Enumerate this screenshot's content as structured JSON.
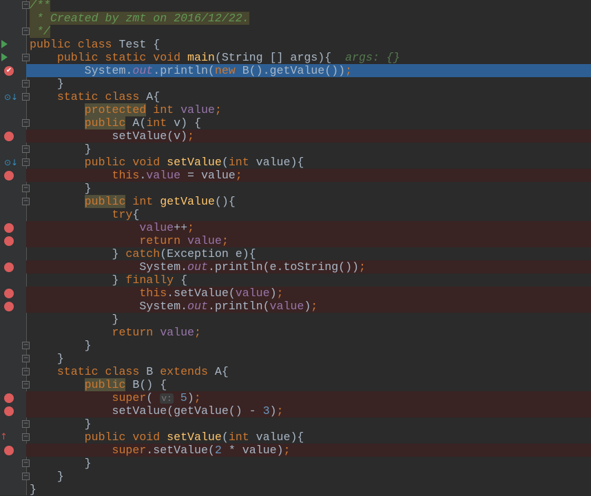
{
  "colors": {
    "keyword": "#cc7832",
    "comment": "#629755",
    "method": "#ffc66d",
    "field": "#9876aa",
    "number": "#6897bb",
    "text": "#a9b7c6",
    "current_line": "#2d5f94",
    "breakpoint_line": "#3a2323"
  },
  "lines": [
    {
      "fold": "start",
      "t": [
        [
          "/**",
          "cm cmbg"
        ]
      ]
    },
    {
      "t": [
        [
          " * Created by zmt on 2016/12/22.",
          "cm cmbg"
        ]
      ]
    },
    {
      "fold": "end",
      "t": [
        [
          " */",
          "cm cmbg"
        ]
      ]
    },
    {
      "marker": "run",
      "t": [
        [
          "public class ",
          "kw"
        ],
        [
          "Test {",
          "pl"
        ]
      ]
    },
    {
      "marker": "run",
      "fold": "start",
      "t": [
        [
          "    public static void ",
          "kw"
        ],
        [
          "main",
          "fn"
        ],
        [
          "(String [] args){  ",
          "pl"
        ],
        [
          "args: {}",
          "dbg"
        ]
      ]
    },
    {
      "marker": "breakpoint-check",
      "bg": "cur",
      "t": [
        [
          "        System.",
          "pl"
        ],
        [
          "out",
          "fldi"
        ],
        [
          ".println(",
          "pl"
        ],
        [
          "new ",
          "kw"
        ],
        [
          "B().getValue())",
          "pl"
        ],
        [
          ";",
          "kw"
        ]
      ]
    },
    {
      "fold": "end",
      "t": [
        [
          "    }",
          "pl"
        ]
      ]
    },
    {
      "marker": "implemented",
      "fold": "start",
      "t": [
        [
          "    static class ",
          "kw"
        ],
        [
          "A{",
          "pl"
        ]
      ]
    },
    {
      "t": [
        [
          "        ",
          "pl"
        ],
        [
          "protected",
          "kw warn"
        ],
        [
          " int ",
          "kw"
        ],
        [
          "value",
          "fld"
        ],
        [
          ";",
          "kw"
        ]
      ]
    },
    {
      "fold": "start",
      "t": [
        [
          "        ",
          "pl"
        ],
        [
          "public",
          "kw warn"
        ],
        [
          " A(",
          "pl"
        ],
        [
          "int ",
          "kw"
        ],
        [
          "v) {",
          "pl"
        ]
      ]
    },
    {
      "marker": "breakpoint",
      "bg": "bp",
      "t": [
        [
          "            setValue(v)",
          "pl"
        ],
        [
          ";",
          "kw"
        ]
      ]
    },
    {
      "fold": "end",
      "t": [
        [
          "        }",
          "pl"
        ]
      ]
    },
    {
      "marker": "implemented",
      "fold": "start",
      "t": [
        [
          "        public void ",
          "kw"
        ],
        [
          "setValue",
          "fn"
        ],
        [
          "(",
          "pl"
        ],
        [
          "int ",
          "kw"
        ],
        [
          "value){",
          "pl"
        ]
      ]
    },
    {
      "marker": "breakpoint",
      "bg": "bp",
      "t": [
        [
          "            this",
          "kw"
        ],
        [
          ".",
          "pl"
        ],
        [
          "value",
          "fld"
        ],
        [
          " = value",
          "pl"
        ],
        [
          ";",
          "kw"
        ]
      ]
    },
    {
      "fold": "end",
      "t": [
        [
          "        }",
          "pl"
        ]
      ]
    },
    {
      "fold": "start",
      "t": [
        [
          "        ",
          "pl"
        ],
        [
          "public",
          "kw warn"
        ],
        [
          " int ",
          "kw"
        ],
        [
          "getValue",
          "fn"
        ],
        [
          "(){",
          "pl"
        ]
      ]
    },
    {
      "t": [
        [
          "            try",
          "kw"
        ],
        [
          "{",
          "pl"
        ]
      ]
    },
    {
      "marker": "breakpoint",
      "bg": "bp",
      "t": [
        [
          "                ",
          "pl"
        ],
        [
          "value",
          "fld"
        ],
        [
          "++",
          "pl"
        ],
        [
          ";",
          "kw"
        ]
      ]
    },
    {
      "marker": "breakpoint",
      "bg": "bp",
      "t": [
        [
          "                return ",
          "kw"
        ],
        [
          "value",
          "fld"
        ],
        [
          ";",
          "kw"
        ]
      ]
    },
    {
      "t": [
        [
          "            } ",
          "pl"
        ],
        [
          "catch",
          "kw"
        ],
        [
          "(Exception e){",
          "pl"
        ]
      ]
    },
    {
      "marker": "breakpoint",
      "bg": "bp",
      "t": [
        [
          "                System.",
          "pl"
        ],
        [
          "out",
          "fldi"
        ],
        [
          ".println(e.toString())",
          "pl"
        ],
        [
          ";",
          "kw"
        ]
      ]
    },
    {
      "t": [
        [
          "            } ",
          "pl"
        ],
        [
          "finally ",
          "kw"
        ],
        [
          "{",
          "pl"
        ]
      ]
    },
    {
      "marker": "breakpoint",
      "bg": "bp",
      "t": [
        [
          "                this",
          "kw"
        ],
        [
          ".setValue(",
          "pl"
        ],
        [
          "value",
          "fld"
        ],
        [
          ")",
          "pl"
        ],
        [
          ";",
          "kw"
        ]
      ]
    },
    {
      "marker": "breakpoint",
      "bg": "bp",
      "t": [
        [
          "                System.",
          "pl"
        ],
        [
          "out",
          "fldi"
        ],
        [
          ".println(",
          "pl"
        ],
        [
          "value",
          "fld"
        ],
        [
          ")",
          "pl"
        ],
        [
          ";",
          "kw"
        ]
      ]
    },
    {
      "t": [
        [
          "            }",
          "pl"
        ]
      ]
    },
    {
      "t": [
        [
          "            return ",
          "kw"
        ],
        [
          "value",
          "fld"
        ],
        [
          ";",
          "kw"
        ]
      ]
    },
    {
      "fold": "end",
      "t": [
        [
          "        }",
          "pl"
        ]
      ]
    },
    {
      "fold": "end",
      "t": [
        [
          "    }",
          "pl"
        ]
      ]
    },
    {
      "fold": "start",
      "t": [
        [
          "    static class ",
          "kw"
        ],
        [
          "B ",
          "pl"
        ],
        [
          "extends ",
          "kw"
        ],
        [
          "A{",
          "pl"
        ]
      ]
    },
    {
      "fold": "start",
      "t": [
        [
          "        ",
          "pl"
        ],
        [
          "public",
          "kw warn"
        ],
        [
          " B() {",
          "pl"
        ]
      ]
    },
    {
      "marker": "breakpoint",
      "bg": "bp",
      "t": [
        [
          "            super",
          "kw"
        ],
        [
          "( ",
          "pl"
        ],
        [
          "v:",
          "hint"
        ],
        [
          " ",
          "pl"
        ],
        [
          "5",
          "num"
        ],
        [
          ")",
          "pl"
        ],
        [
          ";",
          "kw"
        ]
      ]
    },
    {
      "marker": "breakpoint",
      "bg": "bp",
      "t": [
        [
          "            setValue(getValue() - ",
          "pl"
        ],
        [
          "3",
          "num"
        ],
        [
          ")",
          "pl"
        ],
        [
          ";",
          "kw"
        ]
      ]
    },
    {
      "fold": "end",
      "t": [
        [
          "        }",
          "pl"
        ]
      ]
    },
    {
      "marker": "overrides",
      "fold": "start",
      "t": [
        [
          "        public void ",
          "kw"
        ],
        [
          "setValue",
          "fn"
        ],
        [
          "(",
          "pl"
        ],
        [
          "int ",
          "kw"
        ],
        [
          "value){",
          "pl"
        ]
      ]
    },
    {
      "marker": "breakpoint",
      "bg": "bp",
      "t": [
        [
          "            super",
          "kw"
        ],
        [
          ".setValue(",
          "pl"
        ],
        [
          "2",
          "num"
        ],
        [
          " * value)",
          "pl"
        ],
        [
          ";",
          "kw"
        ]
      ]
    },
    {
      "fold": "end",
      "t": [
        [
          "        }",
          "pl"
        ]
      ]
    },
    {
      "fold": "end",
      "t": [
        [
          "    }",
          "pl"
        ]
      ]
    },
    {
      "t": [
        [
          "}",
          "pl"
        ]
      ]
    }
  ]
}
